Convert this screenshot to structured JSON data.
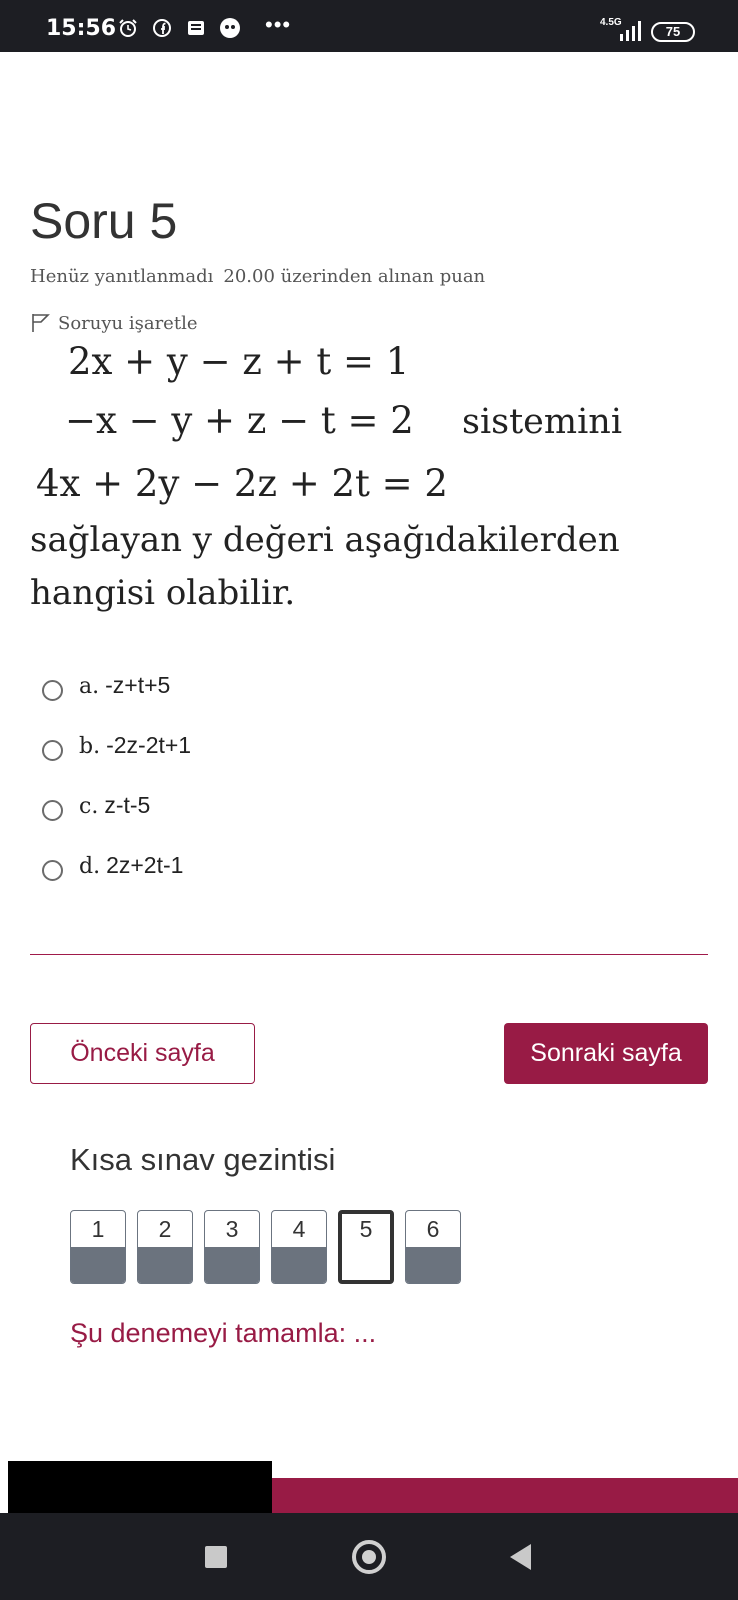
{
  "status_bar": {
    "time": "15:56",
    "network": "4.5G",
    "battery": "75",
    "icons": [
      "alarm-icon",
      "facebook-icon",
      "news-icon",
      "app-icon",
      "more-icon",
      "signal-icon",
      "battery-icon"
    ]
  },
  "question": {
    "title": "Soru 5",
    "status": "Henüz yanıtlanmadı",
    "points": "20.00 üzerinden alınan puan",
    "flag_label": "Soruyu işaretle",
    "equations": {
      "eq1": "2x + y − z + t = 1",
      "eq2": "−x − y + z − t = 2",
      "eq2_suffix": "sistemini",
      "eq3": "4x + 2y − 2z + 2t = 2"
    },
    "text": "sağlayan y değeri aşağıdakilerden hangisi olabilir."
  },
  "answers": [
    {
      "letter": "a.",
      "value": "-z+t+5"
    },
    {
      "letter": "b.",
      "value": "-2z-2t+1"
    },
    {
      "letter": "c.",
      "value": "z-t-5"
    },
    {
      "letter": "d.",
      "value": "2z+2t-1"
    }
  ],
  "buttons": {
    "prev": "Önceki sayfa",
    "next": "Sonraki sayfa"
  },
  "quiz_nav": {
    "title": "Kısa sınav gezintisi",
    "items": [
      "1",
      "2",
      "3",
      "4",
      "5",
      "6"
    ],
    "current": "5",
    "finish": "Şu denemeyi tamamla: ..."
  },
  "colors": {
    "accent": "#981b45",
    "status_bar": "#1d1e23",
    "answered_fill": "#6b737e"
  }
}
